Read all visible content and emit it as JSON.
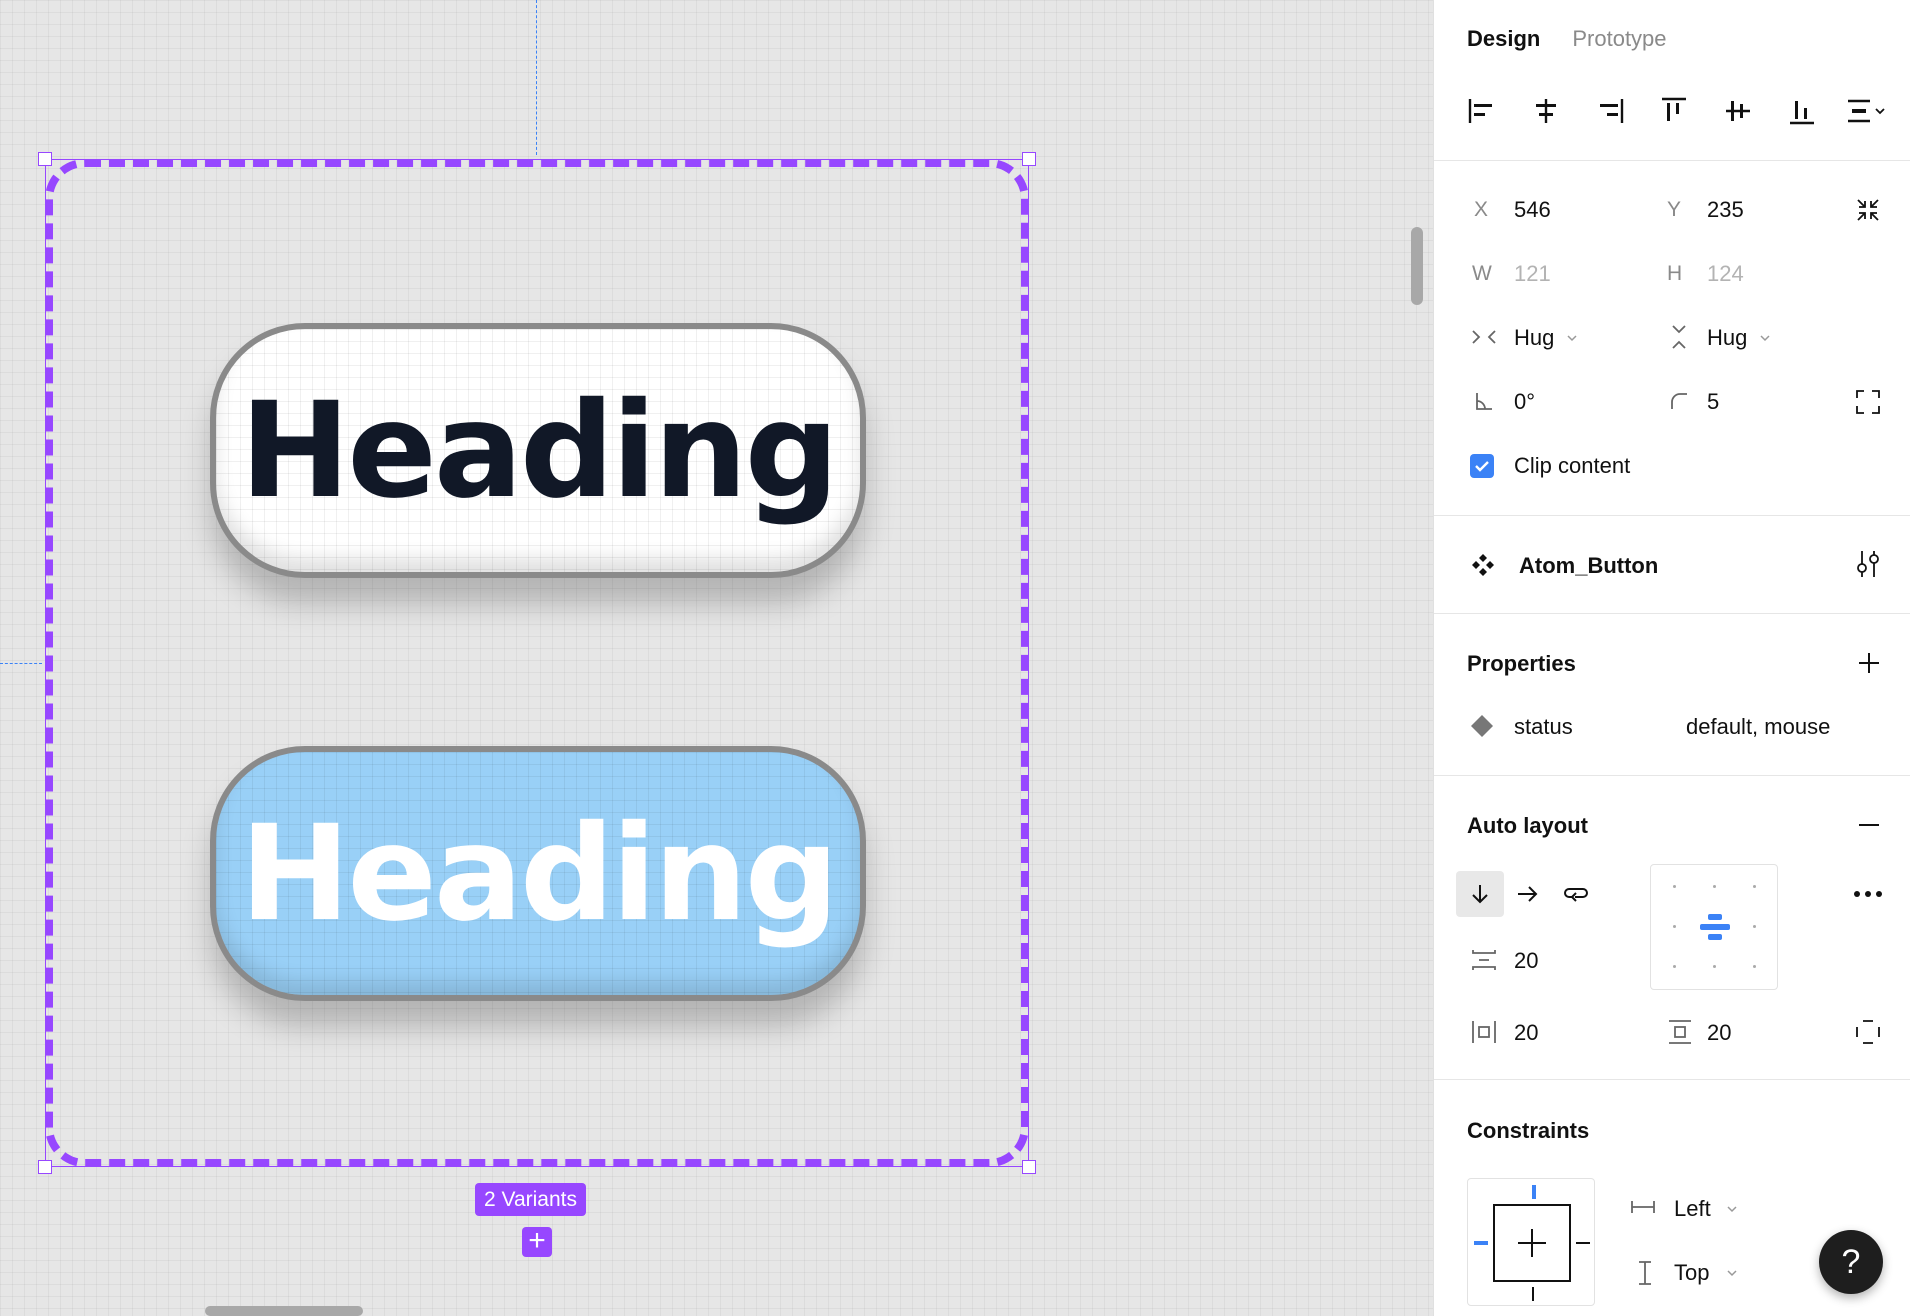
{
  "canvas": {
    "variants_label": "2 Variants",
    "variants_add_glyph": "+",
    "variants": [
      {
        "label": "Heading",
        "status": "default"
      },
      {
        "label": "Heading",
        "status": "mouse"
      }
    ],
    "colors": {
      "selection": "#9747ff",
      "guide": "#3b82f6",
      "mouse_fill": "#99d0f7"
    }
  },
  "panel": {
    "tabs": {
      "design": "Design",
      "prototype": "Prototype"
    },
    "position": {
      "x_label": "X",
      "x": "546",
      "y_label": "Y",
      "y": "235"
    },
    "size": {
      "w_label": "W",
      "w": "121",
      "h_label": "H",
      "h": "124"
    },
    "resizing": {
      "horizontal": "Hug",
      "vertical": "Hug"
    },
    "rotation": "0°",
    "radius": "5",
    "clip_content": {
      "label": "Clip content",
      "checked": true
    },
    "component": {
      "name": "Atom_Button",
      "icon": "component-icon"
    },
    "properties": {
      "title": "Properties",
      "items": [
        {
          "name": "status",
          "values": "default, mouse"
        }
      ]
    },
    "auto_layout": {
      "title": "Auto layout",
      "direction": "vertical",
      "gap": "20",
      "padding_horizontal": "20",
      "padding_vertical": "20"
    },
    "constraints": {
      "title": "Constraints",
      "horizontal": "Left",
      "vertical": "Top"
    },
    "help": "?"
  }
}
